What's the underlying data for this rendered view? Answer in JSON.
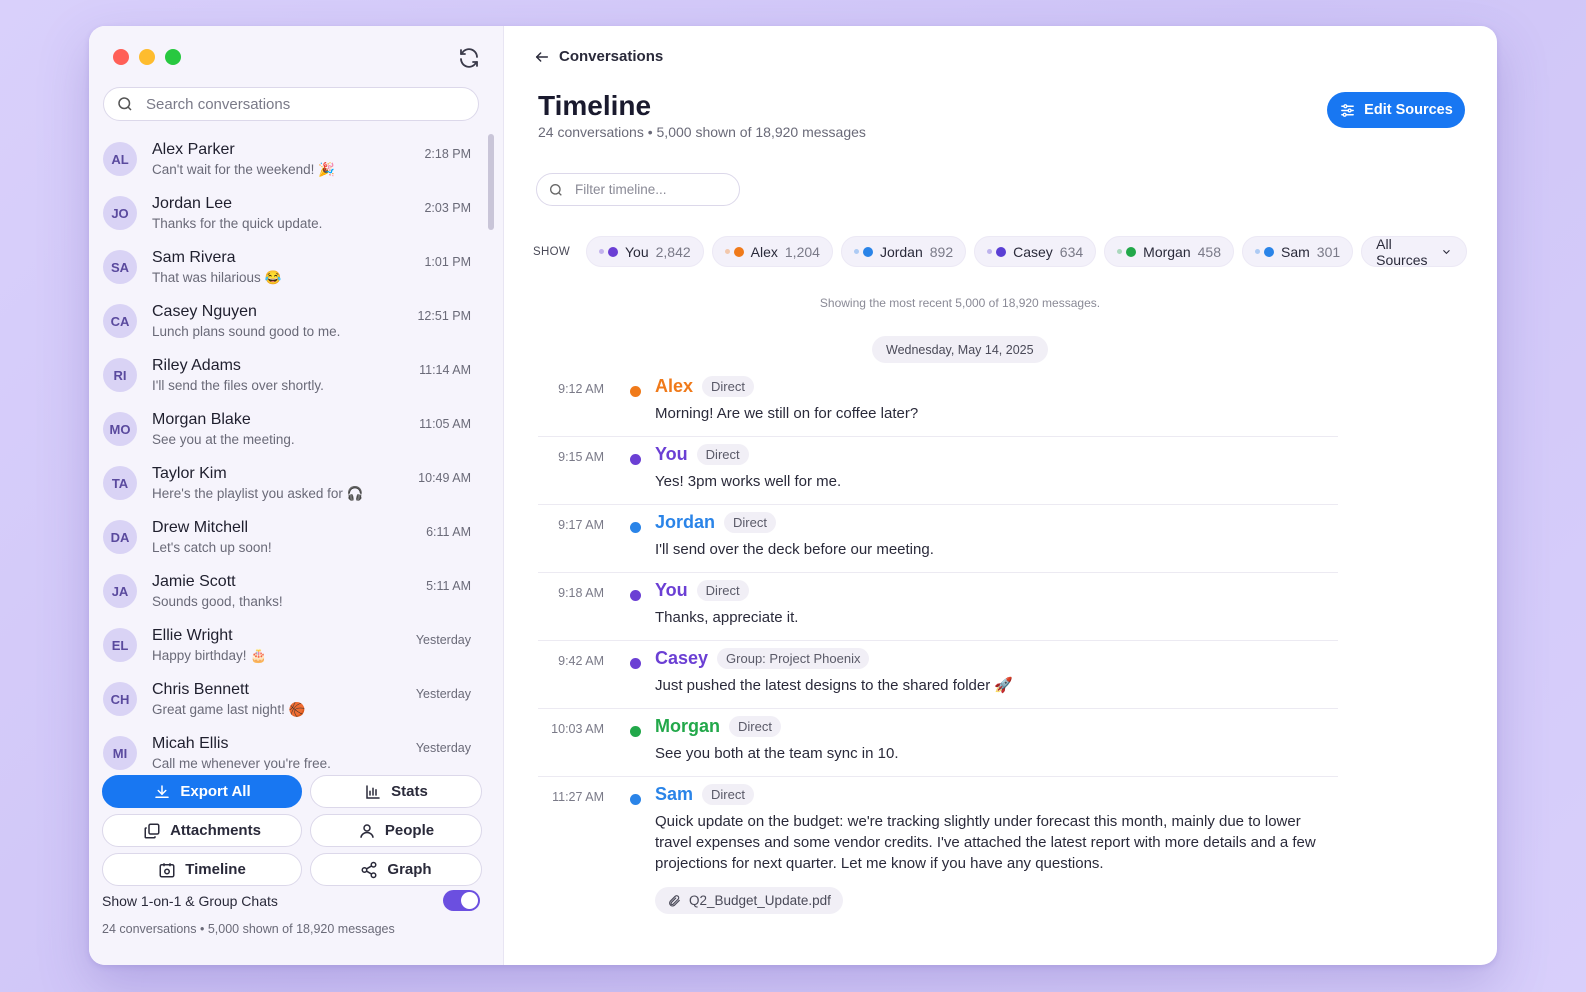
{
  "sidebar": {
    "search_placeholder": "Search conversations",
    "conversations": [
      {
        "initials": "AL",
        "name": "Alex Parker",
        "preview": "Can't wait for the weekend! 🎉",
        "time": "2:18 PM"
      },
      {
        "initials": "JO",
        "name": "Jordan Lee",
        "preview": "Thanks for the quick update.",
        "time": "2:03 PM"
      },
      {
        "initials": "SA",
        "name": "Sam Rivera",
        "preview": "That was hilarious 😂",
        "time": "1:01 PM"
      },
      {
        "initials": "CA",
        "name": "Casey Nguyen",
        "preview": "Lunch plans sound good to me.",
        "time": "12:51 PM"
      },
      {
        "initials": "RI",
        "name": "Riley Adams",
        "preview": "I'll send the files over shortly.",
        "time": "11:14 AM"
      },
      {
        "initials": "MO",
        "name": "Morgan Blake",
        "preview": "See you at the meeting.",
        "time": "11:05 AM"
      },
      {
        "initials": "TA",
        "name": "Taylor Kim",
        "preview": "Here's the playlist you asked for 🎧",
        "time": "10:49 AM"
      },
      {
        "initials": "DA",
        "name": "Drew Mitchell",
        "preview": "Let's catch up soon!",
        "time": "6:11 AM"
      },
      {
        "initials": "JA",
        "name": "Jamie Scott",
        "preview": "Sounds good, thanks!",
        "time": "5:11 AM"
      },
      {
        "initials": "EL",
        "name": "Ellie Wright",
        "preview": "Happy birthday! 🎂",
        "time": "Yesterday"
      },
      {
        "initials": "CH",
        "name": "Chris Bennett",
        "preview": "Great game last night! 🏀",
        "time": "Yesterday"
      },
      {
        "initials": "MI",
        "name": "Micah Ellis",
        "preview": "Call me whenever you're free.",
        "time": "Yesterday"
      }
    ],
    "buttons": {
      "export_all": "Export All",
      "stats": "Stats",
      "attachments": "Attachments",
      "people": "People",
      "timeline": "Timeline",
      "graph": "Graph"
    },
    "toggle_label": "Show 1-on-1 & Group Chats",
    "toggle_on": true,
    "footer": "24 conversations • 5,000 shown of 18,920 messages"
  },
  "main": {
    "back_label": "Conversations",
    "title": "Timeline",
    "subtitle": "24 conversations • 5,000 shown of 18,920 messages",
    "edit_sources": "Edit Sources",
    "filter_placeholder": "Filter timeline...",
    "show_label": "SHOW",
    "chips": [
      {
        "name": "You",
        "count": "2,842",
        "color": "#6b3fd4"
      },
      {
        "name": "Alex",
        "count": "1,204",
        "color": "#f07a1a"
      },
      {
        "name": "Jordan",
        "count": "892",
        "color": "#2a84e8"
      },
      {
        "name": "Casey",
        "count": "634",
        "color": "#5a3fd4"
      },
      {
        "name": "Morgan",
        "count": "458",
        "color": "#22a84a"
      },
      {
        "name": "Sam",
        "count": "301",
        "color": "#2a84e8"
      }
    ],
    "sources_dropdown": "All Sources",
    "notice": "Showing the most recent 5,000 of 18,920 messages.",
    "date": "Wednesday, May 14, 2025",
    "messages": [
      {
        "time": "9:12 AM",
        "name": "Alex",
        "tag": "Direct",
        "color": "#f07a1a",
        "text": "Morning! Are we still on for coffee later?"
      },
      {
        "time": "9:15 AM",
        "name": "You",
        "tag": "Direct",
        "color": "#6b3fd4",
        "text": "Yes! 3pm works well for me."
      },
      {
        "time": "9:17 AM",
        "name": "Jordan",
        "tag": "Direct",
        "color": "#2a84e8",
        "text": "I'll send over the deck before our meeting."
      },
      {
        "time": "9:18 AM",
        "name": "You",
        "tag": "Direct",
        "color": "#6b3fd4",
        "text": "Thanks, appreciate it."
      },
      {
        "time": "9:42 AM",
        "name": "Casey",
        "tag": "Group: Project Phoenix",
        "color": "#6b3fd4",
        "text": "Just pushed the latest designs to the shared folder 🚀"
      },
      {
        "time": "10:03 AM",
        "name": "Morgan",
        "tag": "Direct",
        "color": "#22a84a",
        "text": "See you both at the team sync in 10."
      },
      {
        "time": "11:27 AM",
        "name": "Sam",
        "tag": "Direct",
        "color": "#2a84e8",
        "text": "Quick update on the budget: we're tracking slightly under forecast this month, mainly due to lower travel expenses and some vendor credits. I've attached the latest report with more details and a few projections for next quarter. Let me know if you have any questions.",
        "attachment": "Q2_Budget_Update.pdf"
      }
    ]
  },
  "colors": {
    "accent": "#1877f2",
    "toggle": "#6b4fe0"
  }
}
